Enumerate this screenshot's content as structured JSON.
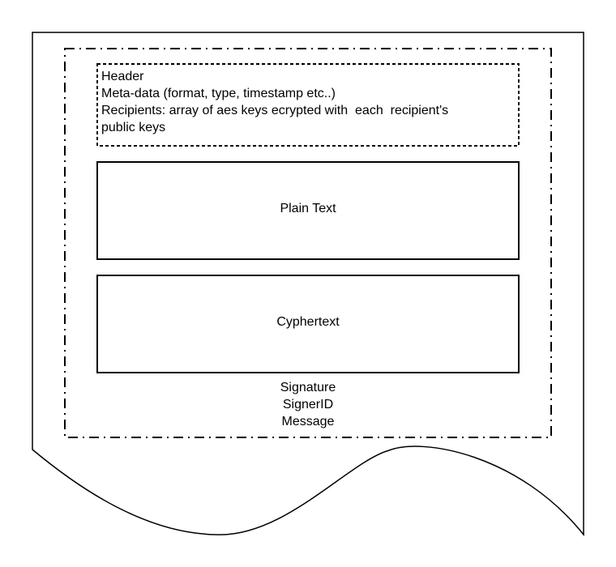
{
  "document": {
    "header": {
      "title": "Header",
      "metadata_line": "Meta-data (format, type, timestamp etc..)",
      "recipients_line_1": "Recipients: array of aes keys ecrypted with  each  recipient's",
      "recipients_line_2": "public keys"
    },
    "plain_text_label": "Plain Text",
    "cyphertext_label": "Cyphertext",
    "signature_lines": [
      "Signature",
      "SignerID",
      "Message"
    ]
  },
  "colors": {
    "stroke": "#000000",
    "background": "#ffffff"
  }
}
